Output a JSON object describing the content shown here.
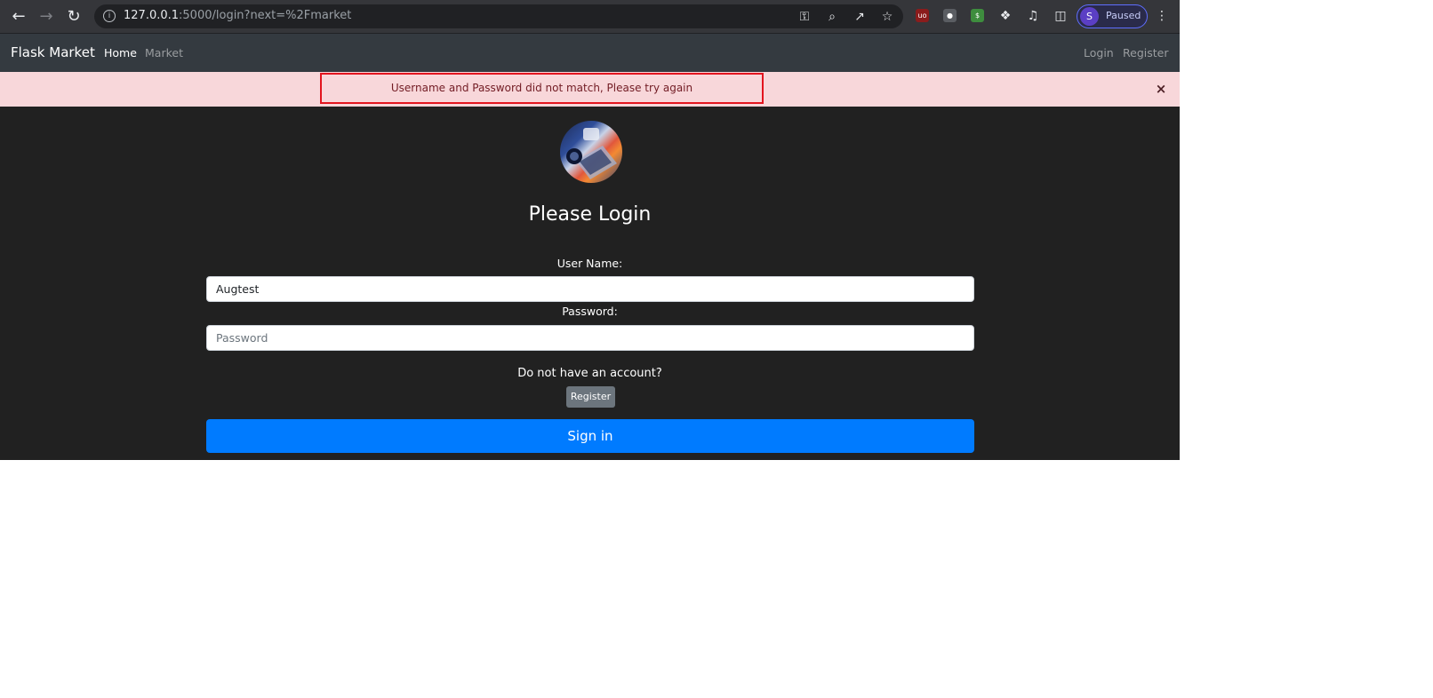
{
  "browser": {
    "url_host": "127.0.0.1",
    "url_rest": ":5000/login?next=%2Fmarket",
    "profile_initial": "S",
    "profile_status": "Paused",
    "icons": [
      "back-icon",
      "forward-icon",
      "reload-icon",
      "site-info-icon",
      "key-icon",
      "zoom-icon",
      "share-icon",
      "star-icon",
      "ublock-extension-icon",
      "extension-icon",
      "dollar-extension-icon",
      "puzzle-extensions-icon",
      "media-icon",
      "side-panel-icon",
      "menu-icon"
    ]
  },
  "navbar": {
    "brand": "Flask Market",
    "left_links": [
      {
        "label": "Home"
      },
      {
        "label": "Market"
      }
    ],
    "right_links": [
      {
        "label": "Login"
      },
      {
        "label": "Register"
      }
    ]
  },
  "alert": {
    "message": "Username and Password did not match, Please try again",
    "close_symbol": "×",
    "color": "#f8d7da"
  },
  "form": {
    "heading": "Please Login",
    "username_label": "User Name:",
    "username_value": "Augtest",
    "password_label": "Password:",
    "password_placeholder": "Password",
    "no_account_text": "Do not have an account?",
    "register_button": "Register",
    "sign_in_button": "Sign in"
  },
  "colors": {
    "page_bg": "#212121",
    "navbar_bg": "#343a40",
    "primary": "#007bff",
    "secondary": "#6c757d"
  }
}
